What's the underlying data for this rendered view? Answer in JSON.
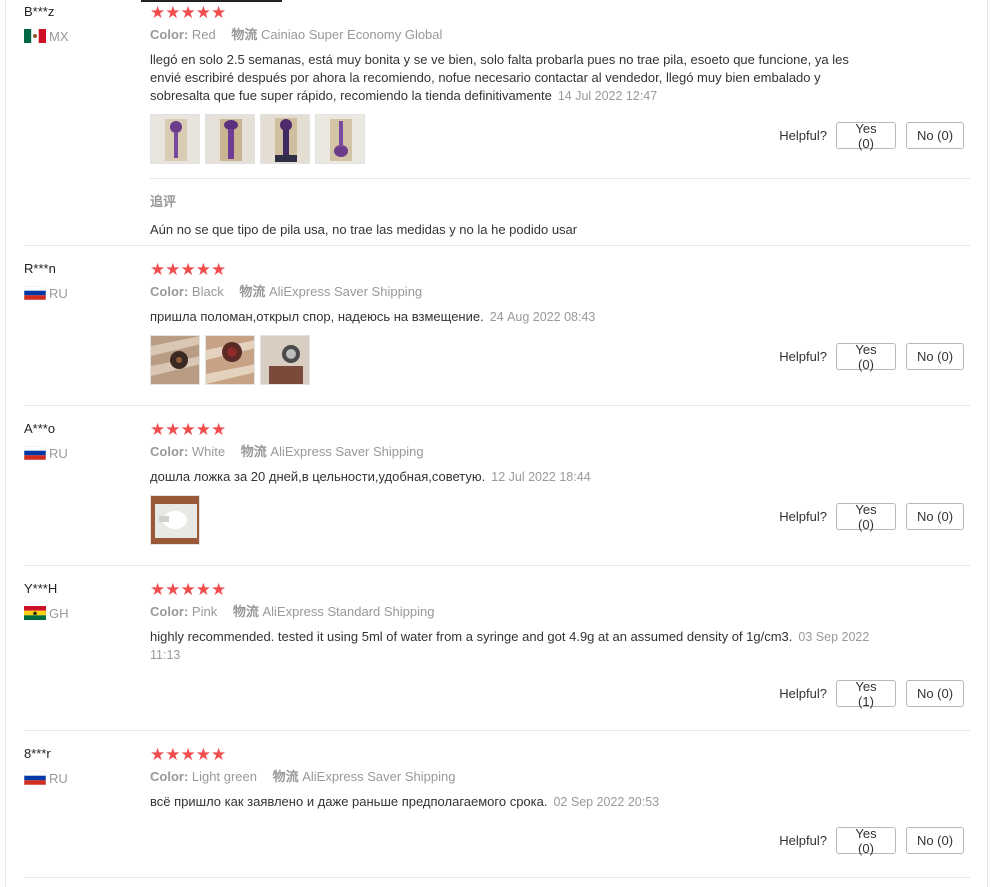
{
  "helpful_label": "Helpful?",
  "stars": "★★★★★",
  "color_label": "Color:",
  "shipping_label": "物流",
  "reviews": [
    {
      "user": "B***z",
      "country": "MX",
      "color": "Red",
      "shipping": "Cainiao Super Economy Global",
      "text": "llegó en solo 2.5 semanas, está muy bonita y se ve bien, solo falta probarla pues no trae pila, esoeto que funcione, ya les envié escribiré después por ahora la recomiendo, nofue necesario contactar al vendedor, llegó muy bien embalado y sobresalta que fue super rápido, recomiendo la tienda definitivamente",
      "date": "14 Jul 2022 12:47",
      "yes": "Yes (0)",
      "no": "No (0)",
      "followup_label": "追评",
      "followup_text": "Aún no se que tipo de pila usa, no trae las medidas y no la he podido usar"
    },
    {
      "user": "R***n",
      "country": "RU",
      "color": "Black",
      "shipping": "AliExpress Saver Shipping",
      "text": "пришла поломан,открыл спор, надеюсь на взмещение.",
      "date": "24 Aug 2022 08:43",
      "yes": "Yes (0)",
      "no": "No (0)"
    },
    {
      "user": "A***o",
      "country": "RU",
      "color": "White",
      "shipping": "AliExpress Saver Shipping",
      "text": "дошла ложка за 20 дней,в цельности,удобная,советую.",
      "date": "12 Jul 2022 18:44",
      "yes": "Yes (0)",
      "no": "No (0)"
    },
    {
      "user": "Y***H",
      "country": "GH",
      "color": "Pink",
      "shipping": "AliExpress Standard Shipping",
      "text": "highly recommended. tested it using 5ml of water from a syringe and got 4.9g at an assumed density of 1g/cm3.",
      "date": "03 Sep 2022 11:13",
      "yes": "Yes (1)",
      "no": "No (0)"
    },
    {
      "user": "8***r",
      "country": "RU",
      "color": "Light green",
      "shipping": "AliExpress Saver Shipping",
      "text": "всё пришло как заявлено и даже раньше предполагаемого срока.",
      "date": "02 Sep 2022 20:53",
      "yes": "Yes (0)",
      "no": "No (0)"
    }
  ]
}
